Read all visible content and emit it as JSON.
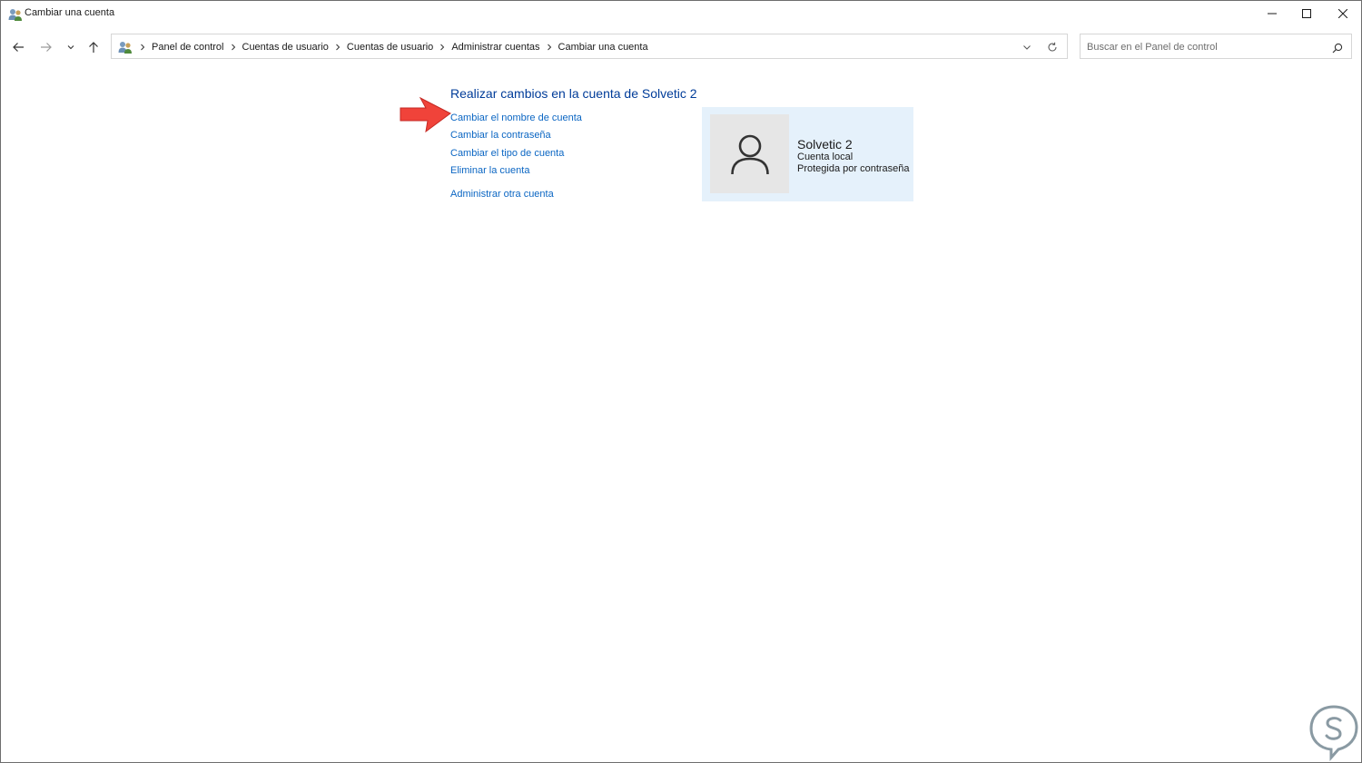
{
  "window": {
    "title": "Cambiar una cuenta",
    "controls": [
      "minimize",
      "maximize",
      "close"
    ]
  },
  "navigation": {
    "breadcrumb": [
      "Panel de control",
      "Cuentas de usuario",
      "Cuentas de usuario",
      "Administrar cuentas",
      "Cambiar una cuenta"
    ],
    "search_placeholder": "Buscar en el Panel de control"
  },
  "main": {
    "heading": "Realizar cambios en la cuenta de Solvetic 2",
    "links": [
      "Cambiar el nombre de cuenta",
      "Cambiar la contraseña",
      "Cambiar el tipo de cuenta",
      "Eliminar la cuenta"
    ],
    "other_link": "Administrar otra cuenta"
  },
  "account": {
    "name": "Solvetic 2",
    "type": "Cuenta local",
    "protection": "Protegida por contraseña"
  },
  "icons": {
    "title_icon": "users-icon",
    "back": "arrow-left-icon",
    "forward": "arrow-right-icon",
    "recent": "chevron-down-icon",
    "up": "arrow-up-icon",
    "refresh": "refresh-icon",
    "search": "search-icon",
    "avatar": "user-icon",
    "annotation": "red-arrow-icon"
  },
  "colors": {
    "heading": "#003c99",
    "link": "#0b66c3",
    "tile_background": "#e5f1fb",
    "annotation_arrow": "#f0433a"
  }
}
